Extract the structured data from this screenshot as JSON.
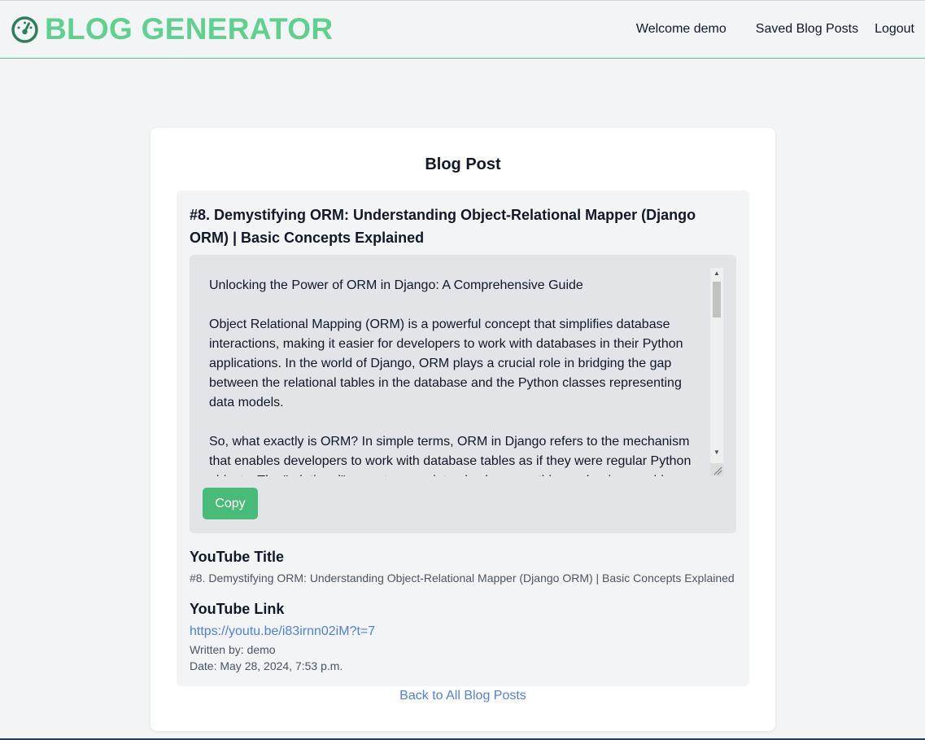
{
  "header": {
    "brand": "BLOG GENERATOR",
    "brand_icon": "speedometer-icon",
    "welcome": "Welcome demo",
    "saved_link": "Saved Blog Posts",
    "logout_link": "Logout",
    "accent_color": "#5ed18f"
  },
  "main": {
    "card_title": "Blog Post",
    "post": {
      "title": "#8. Demystifying ORM: Understanding Object-Relational Mapper (Django ORM) | Basic Concepts Explained",
      "content": [
        "Unlocking the Power of ORM in Django: A Comprehensive Guide",
        "Object Relational Mapping (ORM) is a powerful concept that simplifies database interactions, making it easier for developers to work with databases in their Python applications. In the world of Django, ORM plays a crucial role in bridging the gap between the relational tables in the database and the Python classes representing data models.",
        "So, what exactly is ORM? In simple terms, ORM in Django refers to the mechanism that enables developers to work with database tables as if they were regular Python objects. The \"relational\" aspect comes into play because this mechanism enables developers to work seamlessly."
      ],
      "copy_button": "Copy",
      "youtube_title_heading": "YouTube Title",
      "youtube_title": "#8. Demystifying ORM: Understanding Object-Relational Mapper (Django ORM) | Basic Concepts Explained",
      "youtube_link_heading": "YouTube Link",
      "youtube_link": "https://youtu.be/i83irnn02iM?t=7",
      "written_by": "Written by: demo",
      "date": "Date: May 28, 2024, 7:53 p.m."
    },
    "back_link": "Back to All Blog Posts",
    "button_color": "#48bb78",
    "link_color": "#4f80e1"
  }
}
